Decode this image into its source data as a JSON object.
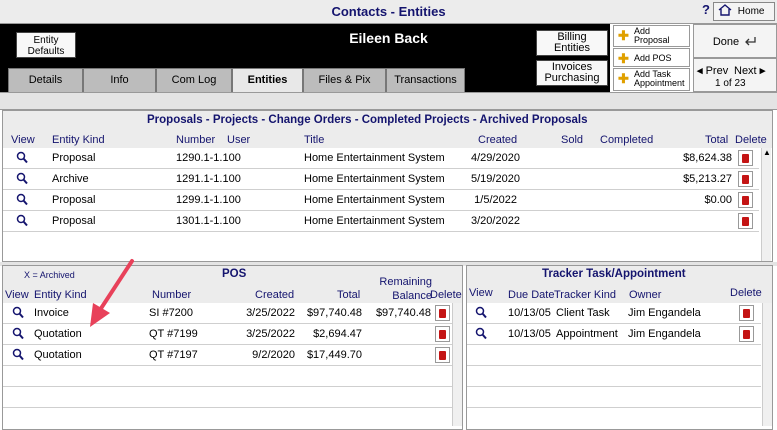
{
  "window": {
    "title": "Contacts - Entities",
    "help": "?",
    "home": "Home"
  },
  "header": {
    "entity_defaults": "Entity\nDefaults",
    "contact_name": "Eileen Back",
    "billing": "Billing\nEntities",
    "invoices": "Invoices\nPurchasing",
    "tabs": [
      "Details",
      "Info",
      "Com Log",
      "Entities",
      "Files & Pix",
      "Transactions"
    ],
    "add_proposal": "Add\nProposal",
    "add_pos": "Add POS",
    "add_task": "Add Task\nAppointment",
    "done": "Done",
    "prev": "Prev",
    "next": "Next",
    "record_count": "1 of 23"
  },
  "proposals": {
    "title": "Proposals - Projects - Change Orders - Completed Projects - Archived Proposals",
    "columns": [
      "View",
      "Entity Kind",
      "Number",
      "User",
      "Title",
      "Created",
      "Sold",
      "Completed",
      "Total",
      "Delete"
    ],
    "rows": [
      {
        "kind": "Proposal",
        "number": "1290.1-1.100",
        "title": "Home Entertainment System",
        "created": "4/29/2020",
        "total": "$8,624.38"
      },
      {
        "kind": "Archive",
        "number": "1291.1-1.100",
        "title": "Home Entertainment System",
        "created": "5/19/2020",
        "total": "$5,213.27"
      },
      {
        "kind": "Proposal",
        "number": "1299.1-1.100",
        "title": "Home Entertainment System",
        "created": "1/5/2022",
        "total": "$0.00"
      },
      {
        "kind": "Proposal",
        "number": "1301.1-1.100",
        "title": "Home Entertainment System",
        "created": "3/20/2022",
        "total": ""
      }
    ]
  },
  "pos": {
    "note": "X = Archived",
    "title": "POS",
    "columns": [
      "View",
      "Entity Kind",
      "Number",
      "Created",
      "Total",
      "Remaining\nBalance",
      "Delete"
    ],
    "rows": [
      {
        "kind": "Invoice",
        "number": "SI #7200",
        "created": "3/25/2022",
        "total": "$97,740.48",
        "balance": "$97,740.48"
      },
      {
        "kind": "Quotation",
        "number": "QT #7199",
        "created": "3/25/2022",
        "total": "$2,694.47",
        "balance": ""
      },
      {
        "kind": "Quotation",
        "number": "QT #7197",
        "created": "9/2/2020",
        "total": "$17,449.70",
        "balance": ""
      }
    ]
  },
  "tracker": {
    "title": "Tracker Task/Appointment",
    "columns": [
      "View",
      "Due Date",
      "Tracker Kind",
      "Owner",
      "Delete"
    ],
    "rows": [
      {
        "due": "10/13/05",
        "kind": "Client Task",
        "owner": "Jim Engandela"
      },
      {
        "due": "10/13/05",
        "kind": "Appointment",
        "owner": "Jim Engandela"
      }
    ]
  },
  "colors": {
    "accent": "#14146e",
    "delete": "#c41414",
    "arrow": "#e8415a"
  }
}
